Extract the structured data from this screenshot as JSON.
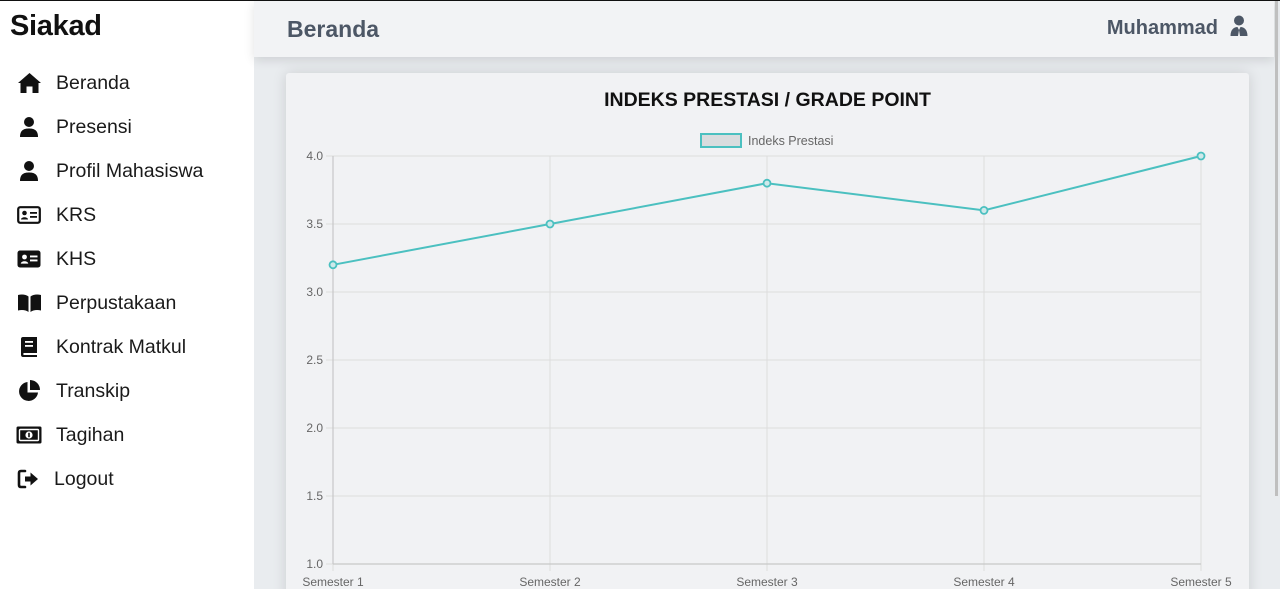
{
  "sidebar": {
    "brand": "Siakad",
    "items": [
      {
        "label": "Beranda",
        "icon": "home-icon"
      },
      {
        "label": "Presensi",
        "icon": "user-icon"
      },
      {
        "label": "Profil Mahasiswa",
        "icon": "user-icon"
      },
      {
        "label": "KRS",
        "icon": "id-card-icon"
      },
      {
        "label": "KHS",
        "icon": "id-card-solid-icon"
      },
      {
        "label": "Perpustakaan",
        "icon": "book-open-icon"
      },
      {
        "label": "Kontrak Matkul",
        "icon": "book-icon"
      },
      {
        "label": "Transkip",
        "icon": "chart-pie-icon"
      },
      {
        "label": "Tagihan",
        "icon": "money-bill-icon"
      },
      {
        "label": "Logout",
        "icon": "sign-out-icon"
      }
    ]
  },
  "header": {
    "title": "Beranda",
    "user_name": "Muhammad"
  },
  "colors": {
    "line": "#4bc0c0",
    "legend_fill": "#d9dcde",
    "grid": "#dddddd",
    "text_dark": "#4d5766"
  },
  "chart_data": {
    "type": "line",
    "title": "INDEKS PRESTASI / GRADE POINT",
    "categories": [
      "Semester 1",
      "Semester 2",
      "Semester 3",
      "Semester 4",
      "Semester 5"
    ],
    "series": [
      {
        "name": "Indeks Prestasi",
        "values": [
          3.2,
          3.5,
          3.8,
          3.6,
          4.0
        ]
      }
    ],
    "ylim": [
      1.0,
      4.0
    ],
    "yticks": [
      "1.0",
      "1.5",
      "2.0",
      "2.5",
      "3.0",
      "3.5",
      "4.0"
    ],
    "grid": true,
    "legend": "top"
  }
}
